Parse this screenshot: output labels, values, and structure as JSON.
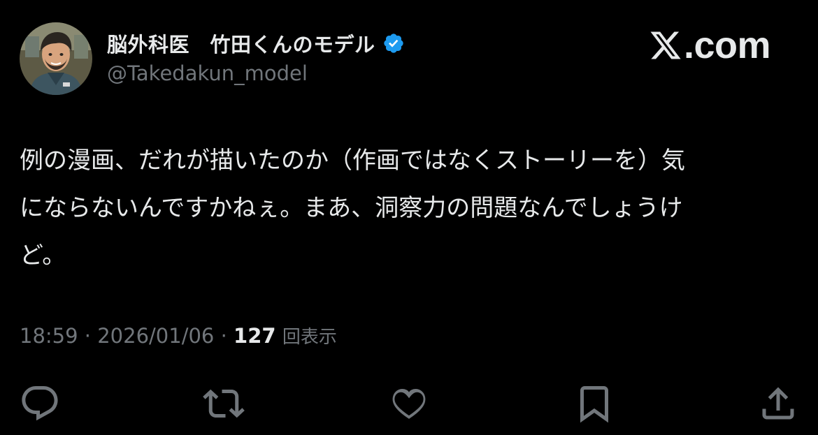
{
  "author": {
    "display_name": "脳外科医　竹田くんのモデル",
    "handle": "@Takedakun_model",
    "verified": true,
    "avatar": "illustrated-avatar"
  },
  "brand": {
    "icon": "x-logo-icon",
    "text": ".com"
  },
  "tweet": {
    "lines": [
      "例の漫画、だれが描いたのか（作画ではなくストーリーを）気",
      "にならないんですかねぇ。まあ、洞察力の問題なんでしょうけ",
      "ど。"
    ]
  },
  "meta": {
    "time": "18:59",
    "separator": " · ",
    "date": "2026/01/06",
    "views_count": "127",
    "views_label": "回表示"
  },
  "actions": [
    {
      "name": "reply",
      "icon": "reply-icon"
    },
    {
      "name": "repost",
      "icon": "repost-icon"
    },
    {
      "name": "like",
      "icon": "heart-icon"
    },
    {
      "name": "bookmark",
      "icon": "bookmark-icon"
    },
    {
      "name": "share",
      "icon": "share-icon"
    }
  ],
  "colors": {
    "background": "#000000",
    "text_primary": "#e7e9ea",
    "text_secondary": "#71767b",
    "verified_blue": "#1d9bf0"
  }
}
